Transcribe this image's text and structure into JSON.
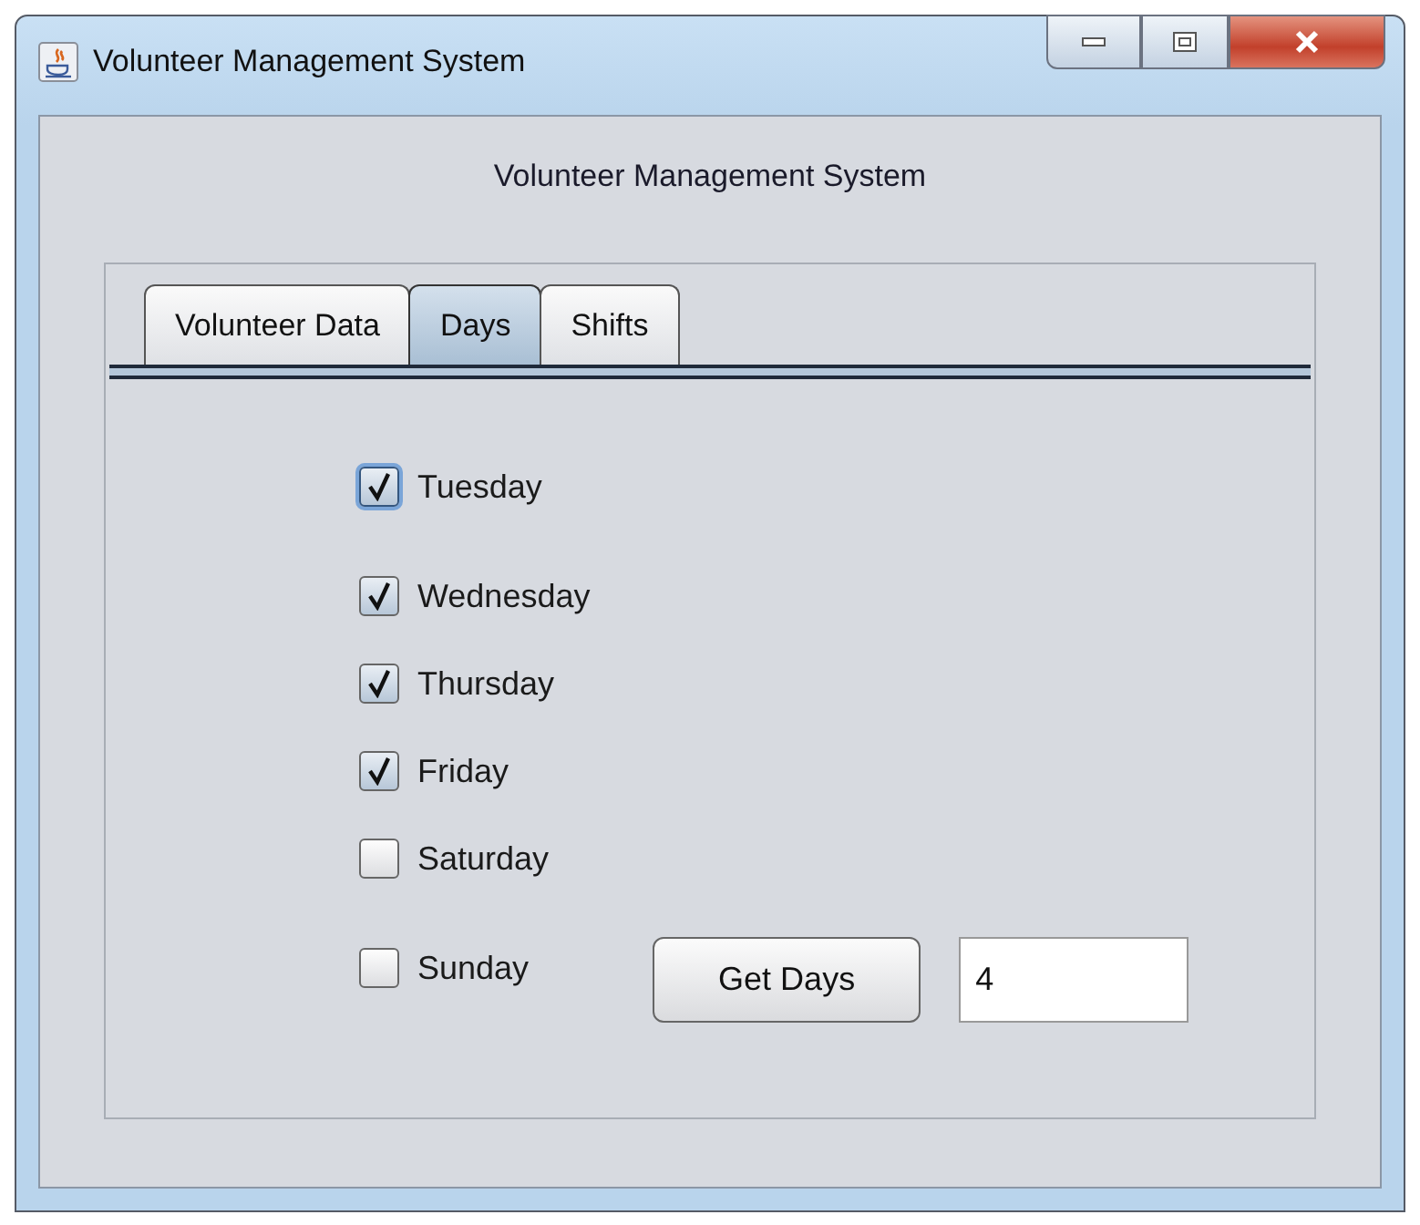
{
  "window": {
    "title": "Volunteer Management System"
  },
  "heading": "Volunteer Management System",
  "tabs": [
    {
      "label": "Volunteer Data",
      "selected": false
    },
    {
      "label": "Days",
      "selected": true
    },
    {
      "label": "Shifts",
      "selected": false
    }
  ],
  "days": [
    {
      "label": "Tuesday",
      "checked": true,
      "focused": true
    },
    {
      "label": "Wednesday",
      "checked": true,
      "focused": false
    },
    {
      "label": "Thursday",
      "checked": true,
      "focused": false
    },
    {
      "label": "Friday",
      "checked": true,
      "focused": false
    },
    {
      "label": "Saturday",
      "checked": false,
      "focused": false
    },
    {
      "label": "Sunday",
      "checked": false,
      "focused": false
    }
  ],
  "button": "Get Days",
  "result": {
    "value": "4"
  }
}
